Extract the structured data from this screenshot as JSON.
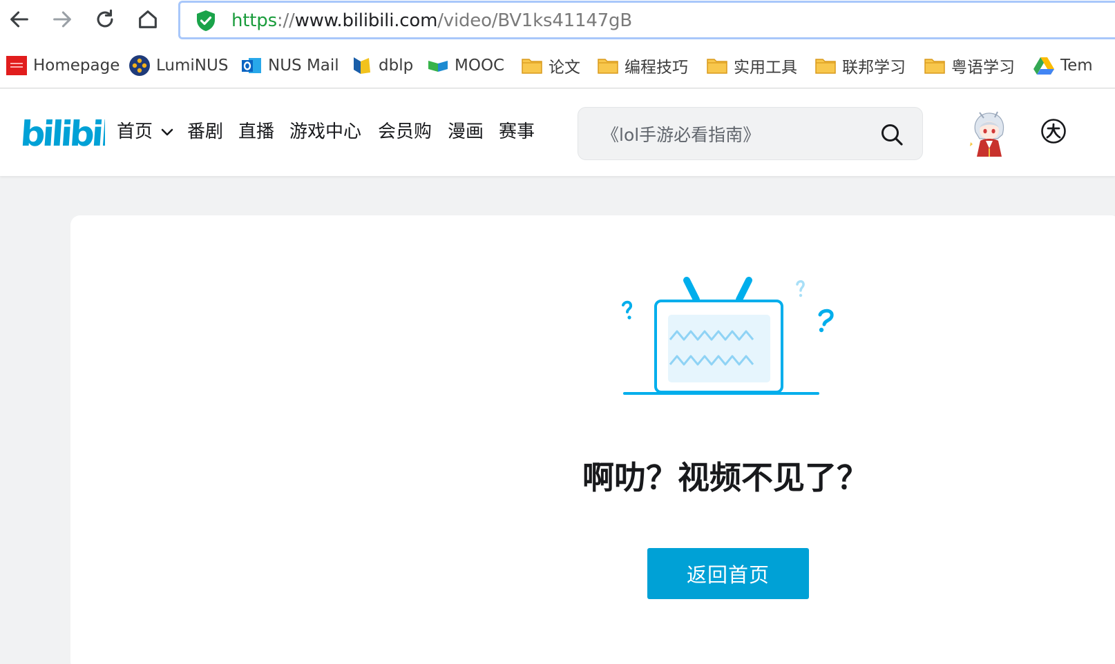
{
  "browser": {
    "url_scheme": "https",
    "url_sep": "://",
    "url_host": "www.bilibili.com",
    "url_path": "/video/BV1ks41147gB"
  },
  "bookmarks": [
    {
      "label": "Homepage",
      "icon": "oracle-icon"
    },
    {
      "label": "LumiNUS",
      "icon": "luminus-icon"
    },
    {
      "label": "NUS Mail",
      "icon": "outlook-icon"
    },
    {
      "label": "dblp",
      "icon": "dblp-icon"
    },
    {
      "label": "MOOC",
      "icon": "mooc-icon"
    },
    {
      "label": "论文",
      "icon": "folder-icon"
    },
    {
      "label": "编程技巧",
      "icon": "folder-icon"
    },
    {
      "label": "实用工具",
      "icon": "folder-icon"
    },
    {
      "label": "联邦学习",
      "icon": "folder-icon"
    },
    {
      "label": "粤语学习",
      "icon": "folder-icon"
    },
    {
      "label": "Tem",
      "icon": "google-drive-icon"
    }
  ],
  "header": {
    "logo_text": "bilibili",
    "nav": [
      "首页",
      "番剧",
      "直播",
      "游戏中心",
      "会员购",
      "漫画",
      "赛事"
    ],
    "search_placeholder": "《lol手游必看指南》",
    "brand_color": "#00a1d6"
  },
  "error": {
    "title": "啊叻？视频不见了？",
    "home_button": "返回首页"
  }
}
